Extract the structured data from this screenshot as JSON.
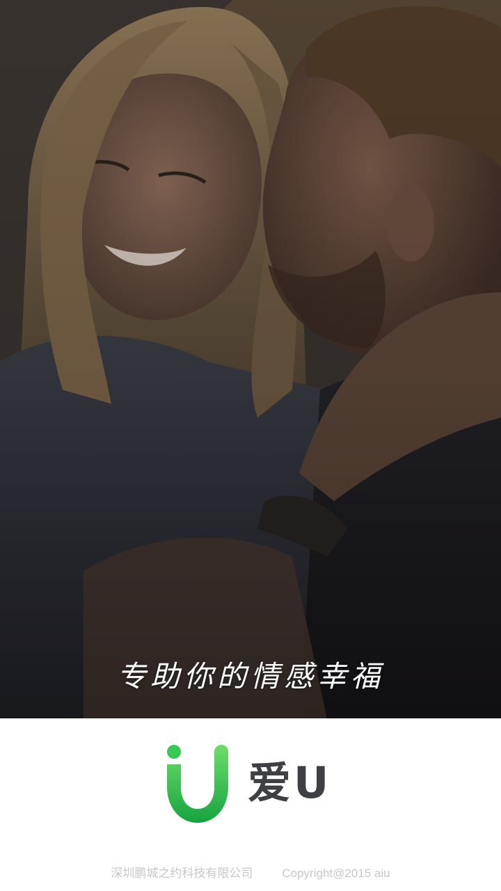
{
  "hero": {
    "slogan": "专助你的情感幸福"
  },
  "brand": {
    "app_name": "爱U",
    "logo_color": "#2dbd4a"
  },
  "footer": {
    "company": "深圳鹏城之约科技有限公司",
    "copyright": "Copyright@2015 aiu"
  }
}
